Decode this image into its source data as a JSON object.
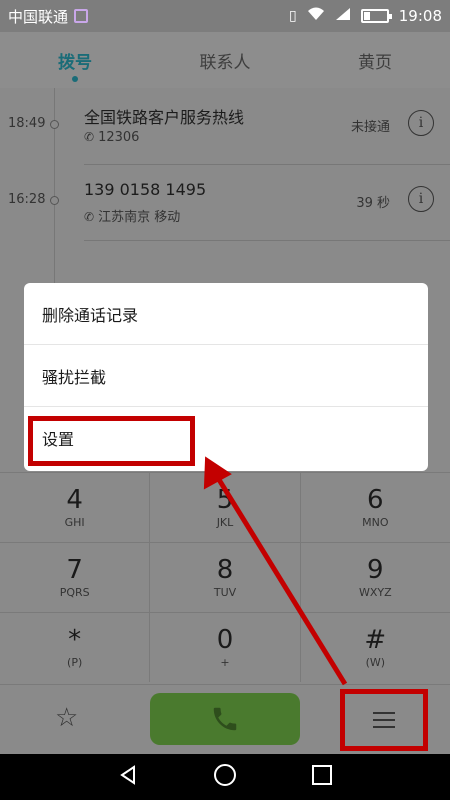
{
  "status_bar": {
    "carrier": "中国联通",
    "signal_label": "G",
    "time": "19:08"
  },
  "tabs": [
    {
      "label": "拨号",
      "active": true
    },
    {
      "label": "联系人",
      "active": false
    },
    {
      "label": "黄页",
      "active": false
    }
  ],
  "call_log": [
    {
      "time": "18:49",
      "name": "全国铁路客户服务热线",
      "detail": "12306",
      "status": "未接通"
    },
    {
      "time": "16:28",
      "name": "139 0158 1495",
      "detail": "江苏南京 移动",
      "status": "39 秒"
    }
  ],
  "menu": {
    "items": [
      {
        "label": "删除通话记录"
      },
      {
        "label": "骚扰拦截"
      },
      {
        "label": "设置"
      }
    ]
  },
  "dialpad": {
    "rows": [
      [
        {
          "digit": "4",
          "letters": "GHI"
        },
        {
          "digit": "5",
          "letters": "JKL"
        },
        {
          "digit": "6",
          "letters": "MNO"
        }
      ],
      [
        {
          "digit": "7",
          "letters": "PQRS"
        },
        {
          "digit": "8",
          "letters": "TUV"
        },
        {
          "digit": "9",
          "letters": "WXYZ"
        }
      ],
      [
        {
          "digit": "*",
          "letters": "(P)"
        },
        {
          "digit": "0",
          "letters": "+"
        },
        {
          "digit": "#",
          "letters": "(W)"
        }
      ]
    ]
  },
  "info_glyph": "i",
  "colors": {
    "accent": "#1a6c78",
    "call_button": "#4a7a2e",
    "annotation_red": "#c30000"
  }
}
